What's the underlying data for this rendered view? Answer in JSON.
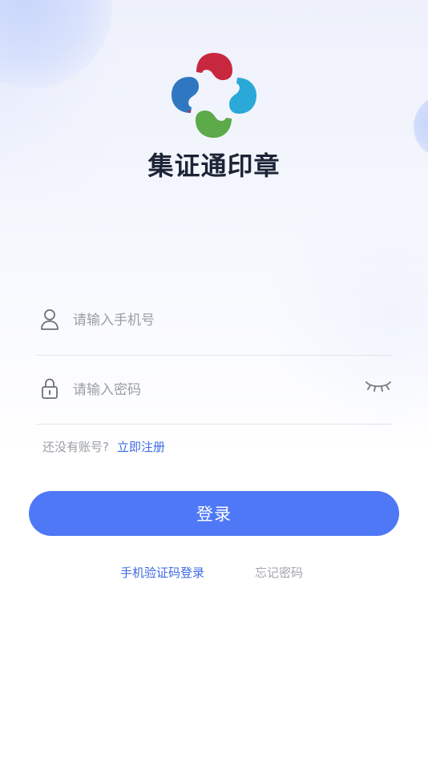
{
  "app": {
    "name": "集证通印章"
  },
  "login": {
    "phone_placeholder": "请输入手机号",
    "password_placeholder": "请输入密码",
    "register_prompt": "还没有账号?",
    "register_link": "立即注册",
    "submit_label": "登录",
    "sms_login_label": "手机验证码登录",
    "forgot_password_label": "忘记密码"
  },
  "icons": {
    "logo": "clover-logo",
    "phone_field": "user-icon",
    "password_field": "lock-icon",
    "toggle_visibility": "eye-closed-icon"
  },
  "colors": {
    "primary": "#4e78f6",
    "link": "#3d6ae0",
    "title": "#1c2436",
    "placeholder": "#9a9da5",
    "logo_red": "#c8283f",
    "logo_blue": "#2f78c1",
    "logo_cyan": "#2aa9d9",
    "logo_green": "#5caa4a"
  }
}
